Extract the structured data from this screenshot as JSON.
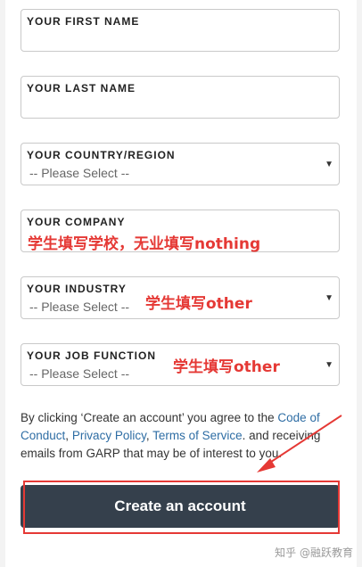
{
  "fields": [
    {
      "label": "YOUR FIRST NAME",
      "value": ""
    },
    {
      "label": "YOUR LAST NAME",
      "value": ""
    },
    {
      "label": "YOUR COUNTRY/REGION",
      "value": "-- Please Select --"
    },
    {
      "label": "YOUR COMPANY",
      "value": ""
    },
    {
      "label": "YOUR INDUSTRY",
      "value": "-- Please Select --"
    },
    {
      "label": "YOUR JOB FUNCTION",
      "value": "-- Please Select --"
    }
  ],
  "annotations": {
    "company": "学生填写学校，无业填写nothing",
    "industry": "学生填写other",
    "job_function": "学生填写other"
  },
  "terms": {
    "prefix": "By clicking ‘Create an account’ you agree to the ",
    "code_of_conduct": "Code of Conduct",
    "sep1": ", ",
    "privacy_policy": "Privacy Policy",
    "sep2": ", ",
    "terms_of_service": "Terms of Service",
    "suffix": ". and receiving emails from GARP that may be of interest to you."
  },
  "button": {
    "label": "Create an account"
  },
  "watermark": "知乎 @融跃教育",
  "colors": {
    "button_bg": "#35404c",
    "annotation": "#e53935",
    "link": "#2e6da4"
  }
}
